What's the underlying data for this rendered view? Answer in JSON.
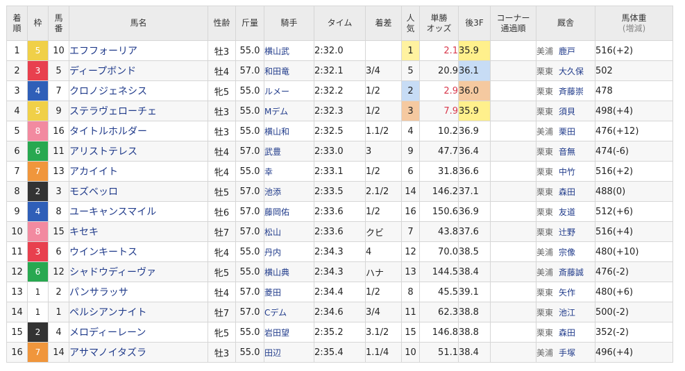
{
  "headers": {
    "finish": "着順",
    "frame": "枠",
    "number": "馬番",
    "horse": "馬名",
    "sexage": "性齢",
    "weight": "斤量",
    "jockey": "騎手",
    "time": "タイム",
    "margin": "着差",
    "popularity": "人気",
    "odds": "単勝オッズ",
    "last3f": "後3F",
    "corner": "コーナー通過順",
    "trainer": "厩舎",
    "bodyweight": "馬体重(増減)"
  },
  "rows": [
    {
      "finish": "1",
      "frame": "5",
      "number": "10",
      "horse": "エフフォーリア",
      "sexage": "牡3",
      "weight": "55.0",
      "jockey": "横山武",
      "time": "2:32.0",
      "margin": "",
      "popularity": "1",
      "odds": "2.1",
      "last3f": "35.9",
      "corner": "",
      "belong": "美浦",
      "trainer": "鹿戸",
      "bodyweight": "516(+2)"
    },
    {
      "finish": "2",
      "frame": "3",
      "number": "5",
      "horse": "ディープボンド",
      "sexage": "牡4",
      "weight": "57.0",
      "jockey": "和田竜",
      "time": "2:32.1",
      "margin": "3/4",
      "popularity": "5",
      "odds": "20.9",
      "last3f": "36.1",
      "corner": "",
      "belong": "栗東",
      "trainer": "大久保",
      "bodyweight": "502"
    },
    {
      "finish": "3",
      "frame": "4",
      "number": "7",
      "horse": "クロノジェネシス",
      "sexage": "牝5",
      "weight": "55.0",
      "jockey": "ルメー",
      "time": "2:32.2",
      "margin": "1/2",
      "popularity": "2",
      "odds": "2.9",
      "last3f": "36.0",
      "corner": "",
      "belong": "栗東",
      "trainer": "斉藤崇",
      "bodyweight": "478"
    },
    {
      "finish": "4",
      "frame": "5",
      "number": "9",
      "horse": "ステラヴェローチェ",
      "sexage": "牡3",
      "weight": "55.0",
      "jockey": "Mデム",
      "time": "2:32.3",
      "margin": "1/2",
      "popularity": "3",
      "odds": "7.9",
      "last3f": "35.9",
      "corner": "",
      "belong": "栗東",
      "trainer": "須貝",
      "bodyweight": "498(+4)"
    },
    {
      "finish": "5",
      "frame": "8",
      "number": "16",
      "horse": "タイトルホルダー",
      "sexage": "牡3",
      "weight": "55.0",
      "jockey": "横山和",
      "time": "2:32.5",
      "margin": "1.1/2",
      "popularity": "4",
      "odds": "10.2",
      "last3f": "36.9",
      "corner": "",
      "belong": "美浦",
      "trainer": "栗田",
      "bodyweight": "476(+12)"
    },
    {
      "finish": "6",
      "frame": "6",
      "number": "11",
      "horse": "アリストテレス",
      "sexage": "牡4",
      "weight": "57.0",
      "jockey": "武豊",
      "time": "2:33.0",
      "margin": "3",
      "popularity": "9",
      "odds": "47.7",
      "last3f": "36.4",
      "corner": "",
      "belong": "栗東",
      "trainer": "音無",
      "bodyweight": "474(-6)"
    },
    {
      "finish": "7",
      "frame": "7",
      "number": "13",
      "horse": "アカイイト",
      "sexage": "牝4",
      "weight": "55.0",
      "jockey": "幸",
      "time": "2:33.1",
      "margin": "1/2",
      "popularity": "6",
      "odds": "31.8",
      "last3f": "36.6",
      "corner": "",
      "belong": "栗東",
      "trainer": "中竹",
      "bodyweight": "516(+2)"
    },
    {
      "finish": "8",
      "frame": "2",
      "number": "3",
      "horse": "モズベッロ",
      "sexage": "牡5",
      "weight": "57.0",
      "jockey": "池添",
      "time": "2:33.5",
      "margin": "2.1/2",
      "popularity": "14",
      "odds": "146.2",
      "last3f": "37.1",
      "corner": "",
      "belong": "栗東",
      "trainer": "森田",
      "bodyweight": "488(0)"
    },
    {
      "finish": "9",
      "frame": "4",
      "number": "8",
      "horse": "ユーキャンスマイル",
      "sexage": "牡6",
      "weight": "57.0",
      "jockey": "藤岡佑",
      "time": "2:33.6",
      "margin": "1/2",
      "popularity": "16",
      "odds": "150.6",
      "last3f": "36.9",
      "corner": "",
      "belong": "栗東",
      "trainer": "友道",
      "bodyweight": "512(+6)"
    },
    {
      "finish": "10",
      "frame": "8",
      "number": "15",
      "horse": "キセキ",
      "sexage": "牡7",
      "weight": "57.0",
      "jockey": "松山",
      "time": "2:33.6",
      "margin": "クビ",
      "popularity": "7",
      "odds": "43.8",
      "last3f": "37.6",
      "corner": "",
      "belong": "栗東",
      "trainer": "辻野",
      "bodyweight": "516(+4)"
    },
    {
      "finish": "11",
      "frame": "3",
      "number": "6",
      "horse": "ウインキートス",
      "sexage": "牝4",
      "weight": "55.0",
      "jockey": "丹内",
      "time": "2:34.3",
      "margin": "4",
      "popularity": "12",
      "odds": "70.0",
      "last3f": "38.5",
      "corner": "",
      "belong": "美浦",
      "trainer": "宗像",
      "bodyweight": "480(+10)"
    },
    {
      "finish": "12",
      "frame": "6",
      "number": "12",
      "horse": "シャドウディーヴァ",
      "sexage": "牝5",
      "weight": "55.0",
      "jockey": "横山典",
      "time": "2:34.3",
      "margin": "ハナ",
      "popularity": "13",
      "odds": "144.5",
      "last3f": "38.4",
      "corner": "",
      "belong": "美浦",
      "trainer": "斎藤誠",
      "bodyweight": "476(-2)"
    },
    {
      "finish": "13",
      "frame": "1",
      "number": "2",
      "horse": "パンサラッサ",
      "sexage": "牡4",
      "weight": "57.0",
      "jockey": "菱田",
      "time": "2:34.4",
      "margin": "1/2",
      "popularity": "8",
      "odds": "45.5",
      "last3f": "39.1",
      "corner": "",
      "belong": "栗東",
      "trainer": "矢作",
      "bodyweight": "480(+6)"
    },
    {
      "finish": "14",
      "frame": "1",
      "number": "1",
      "horse": "ペルシアンナイト",
      "sexage": "牡7",
      "weight": "57.0",
      "jockey": "Cデム",
      "time": "2:34.6",
      "margin": "3/4",
      "popularity": "11",
      "odds": "62.3",
      "last3f": "38.8",
      "corner": "",
      "belong": "栗東",
      "trainer": "池江",
      "bodyweight": "500(-2)"
    },
    {
      "finish": "15",
      "frame": "2",
      "number": "4",
      "horse": "メロディーレーン",
      "sexage": "牝5",
      "weight": "55.0",
      "jockey": "岩田望",
      "time": "2:35.2",
      "margin": "3.1/2",
      "popularity": "15",
      "odds": "146.8",
      "last3f": "38.8",
      "corner": "",
      "belong": "栗東",
      "trainer": "森田",
      "bodyweight": "352(-2)"
    },
    {
      "finish": "16",
      "frame": "7",
      "number": "14",
      "horse": "アサマノイタズラ",
      "sexage": "牡3",
      "weight": "55.0",
      "jockey": "田辺",
      "time": "2:35.4",
      "margin": "1.1/4",
      "popularity": "10",
      "odds": "51.1",
      "last3f": "38.4",
      "corner": "",
      "belong": "美浦",
      "trainer": "手塚",
      "bodyweight": "496(+4)"
    }
  ],
  "colors": {
    "frame_1": "#ffffff",
    "frame_2": "#333333",
    "frame_3": "#e8404e",
    "frame_4": "#2f5fb8",
    "frame_5": "#f0d048",
    "frame_6": "#28a850",
    "frame_7": "#f0963c",
    "frame_8": "#f28aa0",
    "odds_top3": "#d8384c",
    "link": "#1f3a8a"
  }
}
